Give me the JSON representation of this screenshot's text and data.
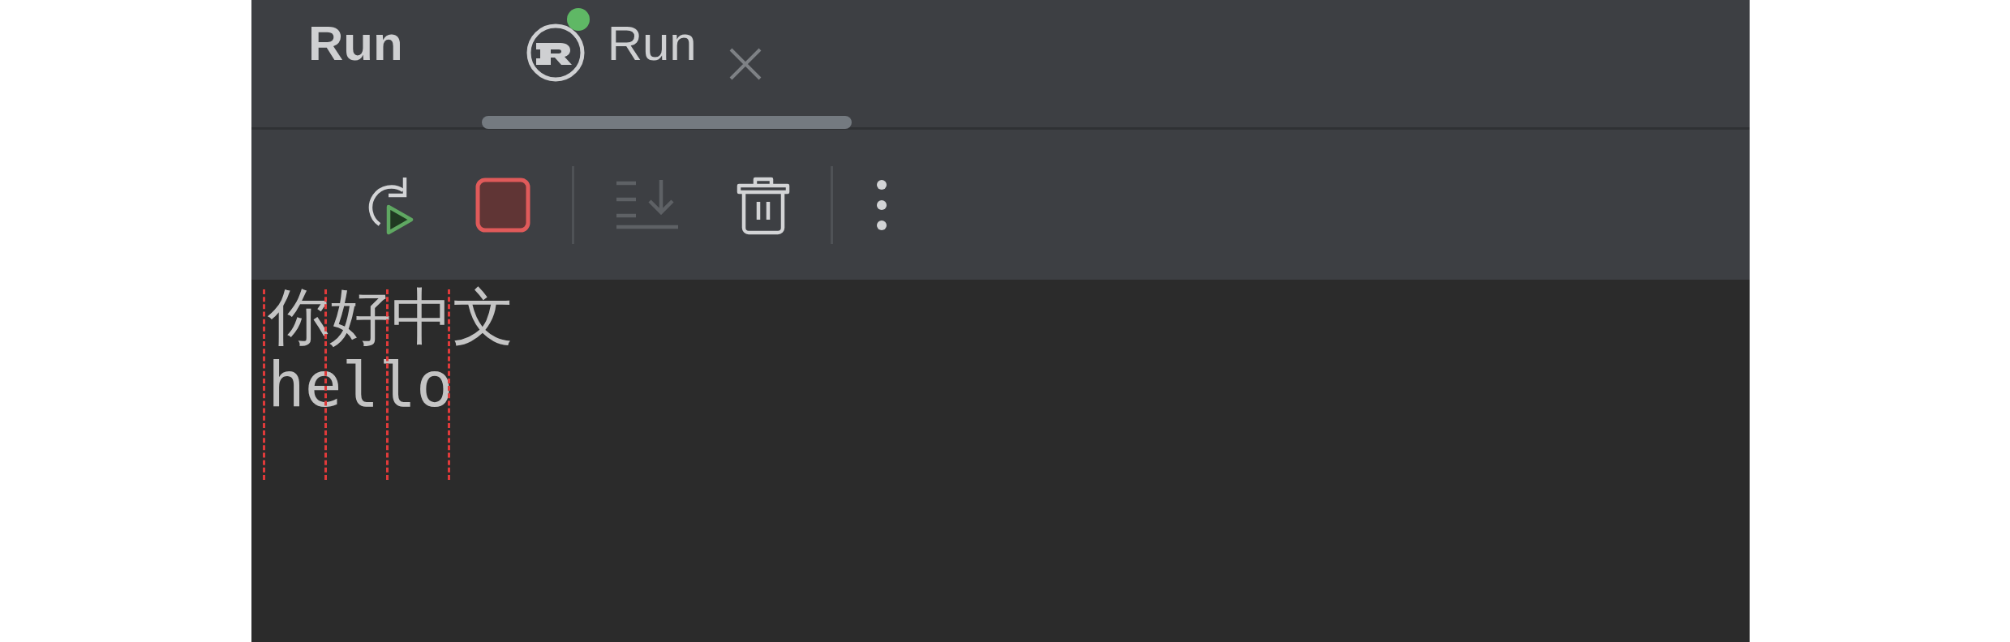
{
  "panel": {
    "title": "Run"
  },
  "tabs": [
    {
      "label": "Run",
      "selected": true,
      "running": true,
      "closable": true
    }
  ],
  "toolbar": [
    {
      "kind": "rerun",
      "disabled": false
    },
    {
      "kind": "stop",
      "disabled": false
    },
    {
      "kind": "separator"
    },
    {
      "kind": "scroll-end",
      "disabled": true
    },
    {
      "kind": "clear",
      "disabled": false
    },
    {
      "kind": "separator"
    },
    {
      "kind": "more",
      "disabled": false
    }
  ],
  "console": {
    "lines": [
      "你好中文",
      "hello"
    ]
  }
}
